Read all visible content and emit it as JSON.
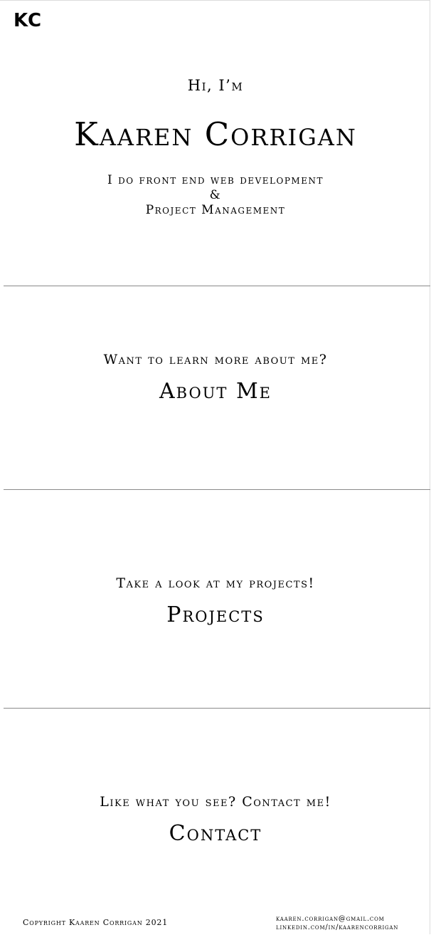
{
  "nav": {
    "logo": "KC"
  },
  "hero": {
    "greeting": "Hi, I’m",
    "name": "Kaaren Corrigan",
    "tagline_line1": "I do front end web development",
    "tagline_line2": "&",
    "tagline_line3": "Project Management"
  },
  "sections": [
    {
      "prompt": "Want to learn more about me?",
      "link": "About Me"
    },
    {
      "prompt": "Take a look at my projects!",
      "link": "Projects"
    },
    {
      "prompt": "Like what you see? Contact me!",
      "link": "Contact"
    }
  ],
  "footer": {
    "copyright": "Copyright Kaaren Corrigan 2021",
    "email": "kaaren.corrigan@gmail.com",
    "linkedin": "linkedin.com/in/kaarencorrigan"
  }
}
